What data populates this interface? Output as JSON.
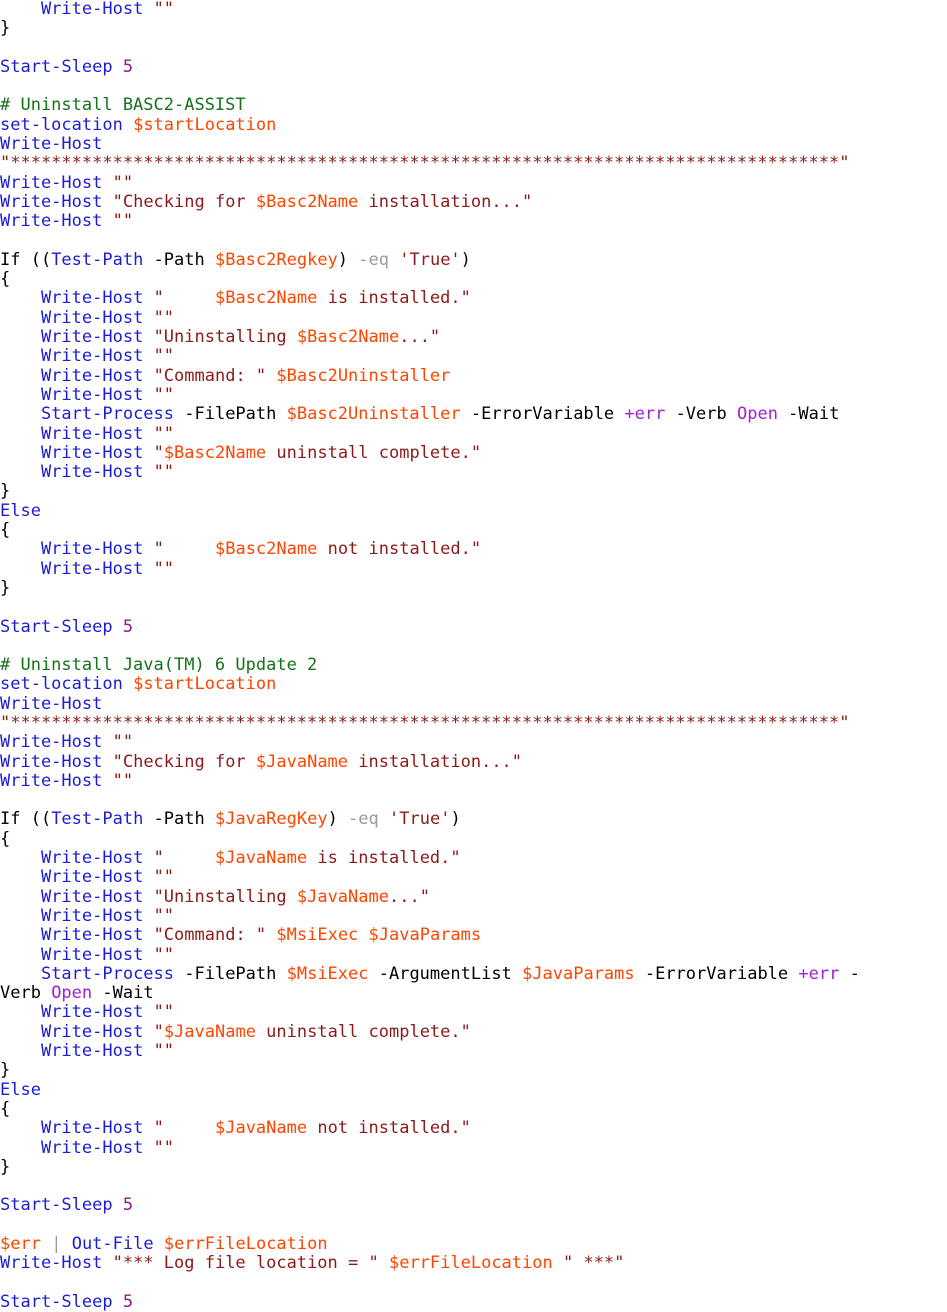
{
  "document": {
    "title": "PowerShell Uninstall Script",
    "language": "PowerShell",
    "font_size_px": 17,
    "line_height_px": 19.3
  },
  "colors": {
    "background": "#ffffff",
    "plain": "#000000",
    "cmdlet": "#1c1cd4",
    "keyword": "#1c1cd4",
    "variable": "#ff4500",
    "string": "#8b1a1a",
    "comment": "#14731a",
    "operator": "#9a9a9a",
    "number": "#8b1a8b",
    "magenta": "#a020d0"
  },
  "lines": [
    {
      "i": 1,
      "tokens": [
        {
          "t": "    ",
          "c": "pln"
        },
        {
          "t": "Write-Host",
          "c": "cmd"
        },
        {
          "t": " ",
          "c": "pln"
        },
        {
          "t": "\"\"",
          "c": "str"
        }
      ]
    },
    {
      "i": 2,
      "tokens": [
        {
          "t": "}",
          "c": "pln"
        }
      ]
    },
    {
      "i": 3,
      "tokens": [
        {
          "t": "",
          "c": "pln"
        }
      ]
    },
    {
      "i": 4,
      "tokens": [
        {
          "t": "Start-Sleep",
          "c": "cmd"
        },
        {
          "t": " ",
          "c": "pln"
        },
        {
          "t": "5",
          "c": "num"
        }
      ]
    },
    {
      "i": 5,
      "tokens": [
        {
          "t": "",
          "c": "pln"
        }
      ]
    },
    {
      "i": 6,
      "tokens": [
        {
          "t": "# Uninstall BASC2-ASSIST",
          "c": "cmt"
        }
      ]
    },
    {
      "i": 7,
      "tokens": [
        {
          "t": "set-location",
          "c": "cmd"
        },
        {
          "t": " ",
          "c": "pln"
        },
        {
          "t": "$startLocation",
          "c": "var"
        }
      ]
    },
    {
      "i": 8,
      "tokens": [
        {
          "t": "Write-Host",
          "c": "cmd"
        }
      ]
    },
    {
      "i": 9,
      "tokens": [
        {
          "t": "\"*********************************************************************************\"",
          "c": "str"
        }
      ]
    },
    {
      "i": 10,
      "tokens": [
        {
          "t": "Write-Host",
          "c": "cmd"
        },
        {
          "t": " ",
          "c": "pln"
        },
        {
          "t": "\"\"",
          "c": "str"
        }
      ]
    },
    {
      "i": 11,
      "tokens": [
        {
          "t": "Write-Host",
          "c": "cmd"
        },
        {
          "t": " ",
          "c": "pln"
        },
        {
          "t": "\"Checking for ",
          "c": "str"
        },
        {
          "t": "$Basc2Name",
          "c": "var"
        },
        {
          "t": " installation...\"",
          "c": "str"
        }
      ]
    },
    {
      "i": 12,
      "tokens": [
        {
          "t": "Write-Host",
          "c": "cmd"
        },
        {
          "t": " ",
          "c": "pln"
        },
        {
          "t": "\"\"",
          "c": "str"
        }
      ]
    },
    {
      "i": 13,
      "tokens": [
        {
          "t": "",
          "c": "pln"
        }
      ]
    },
    {
      "i": 14,
      "tokens": [
        {
          "t": "If ((",
          "c": "pln"
        },
        {
          "t": "Test-Path",
          "c": "cmd"
        },
        {
          "t": " -Path ",
          "c": "pln"
        },
        {
          "t": "$Basc2Regkey",
          "c": "var"
        },
        {
          "t": ") ",
          "c": "pln"
        },
        {
          "t": "-eq",
          "c": "op"
        },
        {
          "t": " ",
          "c": "pln"
        },
        {
          "t": "'True'",
          "c": "str"
        },
        {
          "t": ")",
          "c": "pln"
        }
      ]
    },
    {
      "i": 15,
      "tokens": [
        {
          "t": "{",
          "c": "pln"
        }
      ]
    },
    {
      "i": 16,
      "tokens": [
        {
          "t": "    ",
          "c": "pln"
        },
        {
          "t": "Write-Host",
          "c": "cmd"
        },
        {
          "t": " ",
          "c": "pln"
        },
        {
          "t": "\"     ",
          "c": "str"
        },
        {
          "t": "$Basc2Name",
          "c": "var"
        },
        {
          "t": " is installed.\"",
          "c": "str"
        }
      ]
    },
    {
      "i": 17,
      "tokens": [
        {
          "t": "    ",
          "c": "pln"
        },
        {
          "t": "Write-Host",
          "c": "cmd"
        },
        {
          "t": " ",
          "c": "pln"
        },
        {
          "t": "\"\"",
          "c": "str"
        }
      ]
    },
    {
      "i": 18,
      "tokens": [
        {
          "t": "    ",
          "c": "pln"
        },
        {
          "t": "Write-Host",
          "c": "cmd"
        },
        {
          "t": " ",
          "c": "pln"
        },
        {
          "t": "\"Uninstalling ",
          "c": "str"
        },
        {
          "t": "$Basc2Name",
          "c": "var"
        },
        {
          "t": "...\"",
          "c": "str"
        }
      ]
    },
    {
      "i": 19,
      "tokens": [
        {
          "t": "    ",
          "c": "pln"
        },
        {
          "t": "Write-Host",
          "c": "cmd"
        },
        {
          "t": " ",
          "c": "pln"
        },
        {
          "t": "\"\"",
          "c": "str"
        }
      ]
    },
    {
      "i": 20,
      "tokens": [
        {
          "t": "    ",
          "c": "pln"
        },
        {
          "t": "Write-Host",
          "c": "cmd"
        },
        {
          "t": " ",
          "c": "pln"
        },
        {
          "t": "\"Command: \"",
          "c": "str"
        },
        {
          "t": " ",
          "c": "pln"
        },
        {
          "t": "$Basc2Uninstaller",
          "c": "var"
        }
      ]
    },
    {
      "i": 21,
      "tokens": [
        {
          "t": "    ",
          "c": "pln"
        },
        {
          "t": "Write-Host",
          "c": "cmd"
        },
        {
          "t": " ",
          "c": "pln"
        },
        {
          "t": "\"\"",
          "c": "str"
        }
      ]
    },
    {
      "i": 22,
      "tokens": [
        {
          "t": "    ",
          "c": "pln"
        },
        {
          "t": "Start-Process",
          "c": "cmd"
        },
        {
          "t": " -FilePath ",
          "c": "pln"
        },
        {
          "t": "$Basc2Uninstaller",
          "c": "var"
        },
        {
          "t": " -ErrorVariable ",
          "c": "pln"
        },
        {
          "t": "+err",
          "c": "mag"
        },
        {
          "t": " -Verb ",
          "c": "pln"
        },
        {
          "t": "Open",
          "c": "mag"
        },
        {
          "t": " -Wait",
          "c": "pln"
        }
      ]
    },
    {
      "i": 23,
      "tokens": [
        {
          "t": "    ",
          "c": "pln"
        },
        {
          "t": "Write-Host",
          "c": "cmd"
        },
        {
          "t": " ",
          "c": "pln"
        },
        {
          "t": "\"\"",
          "c": "str"
        }
      ]
    },
    {
      "i": 24,
      "tokens": [
        {
          "t": "    ",
          "c": "pln"
        },
        {
          "t": "Write-Host",
          "c": "cmd"
        },
        {
          "t": " ",
          "c": "pln"
        },
        {
          "t": "\"",
          "c": "str"
        },
        {
          "t": "$Basc2Name",
          "c": "var"
        },
        {
          "t": " uninstall complete.\"",
          "c": "str"
        }
      ]
    },
    {
      "i": 25,
      "tokens": [
        {
          "t": "    ",
          "c": "pln"
        },
        {
          "t": "Write-Host",
          "c": "cmd"
        },
        {
          "t": " ",
          "c": "pln"
        },
        {
          "t": "\"\"",
          "c": "str"
        }
      ]
    },
    {
      "i": 26,
      "tokens": [
        {
          "t": "}",
          "c": "pln"
        }
      ]
    },
    {
      "i": 27,
      "tokens": [
        {
          "t": "Else",
          "c": "kw"
        }
      ]
    },
    {
      "i": 28,
      "tokens": [
        {
          "t": "{",
          "c": "pln"
        }
      ]
    },
    {
      "i": 29,
      "tokens": [
        {
          "t": "    ",
          "c": "pln"
        },
        {
          "t": "Write-Host",
          "c": "cmd"
        },
        {
          "t": " ",
          "c": "pln"
        },
        {
          "t": "\"     ",
          "c": "str"
        },
        {
          "t": "$Basc2Name",
          "c": "var"
        },
        {
          "t": " not installed.\"",
          "c": "str"
        }
      ]
    },
    {
      "i": 30,
      "tokens": [
        {
          "t": "    ",
          "c": "pln"
        },
        {
          "t": "Write-Host",
          "c": "cmd"
        },
        {
          "t": " ",
          "c": "pln"
        },
        {
          "t": "\"\"",
          "c": "str"
        }
      ]
    },
    {
      "i": 31,
      "tokens": [
        {
          "t": "}",
          "c": "pln"
        }
      ]
    },
    {
      "i": 32,
      "tokens": [
        {
          "t": "",
          "c": "pln"
        }
      ]
    },
    {
      "i": 33,
      "tokens": [
        {
          "t": "Start-Sleep",
          "c": "cmd"
        },
        {
          "t": " ",
          "c": "pln"
        },
        {
          "t": "5",
          "c": "num"
        }
      ]
    },
    {
      "i": 34,
      "tokens": [
        {
          "t": "",
          "c": "pln"
        }
      ]
    },
    {
      "i": 35,
      "tokens": [
        {
          "t": "# Uninstall Java(TM) 6 Update 2",
          "c": "cmt"
        }
      ]
    },
    {
      "i": 36,
      "tokens": [
        {
          "t": "set-location",
          "c": "cmd"
        },
        {
          "t": " ",
          "c": "pln"
        },
        {
          "t": "$startLocation",
          "c": "var"
        }
      ]
    },
    {
      "i": 37,
      "tokens": [
        {
          "t": "Write-Host",
          "c": "cmd"
        }
      ]
    },
    {
      "i": 38,
      "tokens": [
        {
          "t": "\"*********************************************************************************\"",
          "c": "str"
        }
      ]
    },
    {
      "i": 39,
      "tokens": [
        {
          "t": "Write-Host",
          "c": "cmd"
        },
        {
          "t": " ",
          "c": "pln"
        },
        {
          "t": "\"\"",
          "c": "str"
        }
      ]
    },
    {
      "i": 40,
      "tokens": [
        {
          "t": "Write-Host",
          "c": "cmd"
        },
        {
          "t": " ",
          "c": "pln"
        },
        {
          "t": "\"Checking for ",
          "c": "str"
        },
        {
          "t": "$JavaName",
          "c": "var"
        },
        {
          "t": " installation...\"",
          "c": "str"
        }
      ]
    },
    {
      "i": 41,
      "tokens": [
        {
          "t": "Write-Host",
          "c": "cmd"
        },
        {
          "t": " ",
          "c": "pln"
        },
        {
          "t": "\"\"",
          "c": "str"
        }
      ]
    },
    {
      "i": 42,
      "tokens": [
        {
          "t": "",
          "c": "pln"
        }
      ]
    },
    {
      "i": 43,
      "tokens": [
        {
          "t": "If ((",
          "c": "pln"
        },
        {
          "t": "Test-Path",
          "c": "cmd"
        },
        {
          "t": " -Path ",
          "c": "pln"
        },
        {
          "t": "$JavaRegKey",
          "c": "var"
        },
        {
          "t": ") ",
          "c": "pln"
        },
        {
          "t": "-eq",
          "c": "op"
        },
        {
          "t": " ",
          "c": "pln"
        },
        {
          "t": "'True'",
          "c": "str"
        },
        {
          "t": ")",
          "c": "pln"
        }
      ]
    },
    {
      "i": 44,
      "tokens": [
        {
          "t": "{",
          "c": "pln"
        }
      ]
    },
    {
      "i": 45,
      "tokens": [
        {
          "t": "    ",
          "c": "pln"
        },
        {
          "t": "Write-Host",
          "c": "cmd"
        },
        {
          "t": " ",
          "c": "pln"
        },
        {
          "t": "\"     ",
          "c": "str"
        },
        {
          "t": "$JavaName",
          "c": "var"
        },
        {
          "t": " is installed.\"",
          "c": "str"
        }
      ]
    },
    {
      "i": 46,
      "tokens": [
        {
          "t": "    ",
          "c": "pln"
        },
        {
          "t": "Write-Host",
          "c": "cmd"
        },
        {
          "t": " ",
          "c": "pln"
        },
        {
          "t": "\"\"",
          "c": "str"
        }
      ]
    },
    {
      "i": 47,
      "tokens": [
        {
          "t": "    ",
          "c": "pln"
        },
        {
          "t": "Write-Host",
          "c": "cmd"
        },
        {
          "t": " ",
          "c": "pln"
        },
        {
          "t": "\"Uninstalling ",
          "c": "str"
        },
        {
          "t": "$JavaName",
          "c": "var"
        },
        {
          "t": "...\"",
          "c": "str"
        }
      ]
    },
    {
      "i": 48,
      "tokens": [
        {
          "t": "    ",
          "c": "pln"
        },
        {
          "t": "Write-Host",
          "c": "cmd"
        },
        {
          "t": " ",
          "c": "pln"
        },
        {
          "t": "\"\"",
          "c": "str"
        }
      ]
    },
    {
      "i": 49,
      "tokens": [
        {
          "t": "    ",
          "c": "pln"
        },
        {
          "t": "Write-Host",
          "c": "cmd"
        },
        {
          "t": " ",
          "c": "pln"
        },
        {
          "t": "\"Command: \"",
          "c": "str"
        },
        {
          "t": " ",
          "c": "pln"
        },
        {
          "t": "$MsiExec",
          "c": "var"
        },
        {
          "t": " ",
          "c": "pln"
        },
        {
          "t": "$JavaParams",
          "c": "var"
        }
      ]
    },
    {
      "i": 50,
      "tokens": [
        {
          "t": "    ",
          "c": "pln"
        },
        {
          "t": "Write-Host",
          "c": "cmd"
        },
        {
          "t": " ",
          "c": "pln"
        },
        {
          "t": "\"\"",
          "c": "str"
        }
      ]
    },
    {
      "i": 51,
      "tokens": [
        {
          "t": "    ",
          "c": "pln"
        },
        {
          "t": "Start-Process",
          "c": "cmd"
        },
        {
          "t": " -FilePath ",
          "c": "pln"
        },
        {
          "t": "$MsiExec",
          "c": "var"
        },
        {
          "t": " -ArgumentList ",
          "c": "pln"
        },
        {
          "t": "$JavaParams",
          "c": "var"
        },
        {
          "t": " -ErrorVariable ",
          "c": "pln"
        },
        {
          "t": "+err",
          "c": "mag"
        },
        {
          "t": " -",
          "c": "pln"
        }
      ]
    },
    {
      "i": 52,
      "tokens": [
        {
          "t": "Verb ",
          "c": "pln"
        },
        {
          "t": "Open",
          "c": "mag"
        },
        {
          "t": " -Wait",
          "c": "pln"
        }
      ]
    },
    {
      "i": 53,
      "tokens": [
        {
          "t": "    ",
          "c": "pln"
        },
        {
          "t": "Write-Host",
          "c": "cmd"
        },
        {
          "t": " ",
          "c": "pln"
        },
        {
          "t": "\"\"",
          "c": "str"
        }
      ]
    },
    {
      "i": 54,
      "tokens": [
        {
          "t": "    ",
          "c": "pln"
        },
        {
          "t": "Write-Host",
          "c": "cmd"
        },
        {
          "t": " ",
          "c": "pln"
        },
        {
          "t": "\"",
          "c": "str"
        },
        {
          "t": "$JavaName",
          "c": "var"
        },
        {
          "t": " uninstall complete.\"",
          "c": "str"
        }
      ]
    },
    {
      "i": 55,
      "tokens": [
        {
          "t": "    ",
          "c": "pln"
        },
        {
          "t": "Write-Host",
          "c": "cmd"
        },
        {
          "t": " ",
          "c": "pln"
        },
        {
          "t": "\"\"",
          "c": "str"
        }
      ]
    },
    {
      "i": 56,
      "tokens": [
        {
          "t": "}",
          "c": "pln"
        }
      ]
    },
    {
      "i": 57,
      "tokens": [
        {
          "t": "Else",
          "c": "kw"
        }
      ]
    },
    {
      "i": 58,
      "tokens": [
        {
          "t": "{",
          "c": "pln"
        }
      ]
    },
    {
      "i": 59,
      "tokens": [
        {
          "t": "    ",
          "c": "pln"
        },
        {
          "t": "Write-Host",
          "c": "cmd"
        },
        {
          "t": " ",
          "c": "pln"
        },
        {
          "t": "\"     ",
          "c": "str"
        },
        {
          "t": "$JavaName",
          "c": "var"
        },
        {
          "t": " not installed.\"",
          "c": "str"
        }
      ]
    },
    {
      "i": 60,
      "tokens": [
        {
          "t": "    ",
          "c": "pln"
        },
        {
          "t": "Write-Host",
          "c": "cmd"
        },
        {
          "t": " ",
          "c": "pln"
        },
        {
          "t": "\"\"",
          "c": "str"
        }
      ]
    },
    {
      "i": 61,
      "tokens": [
        {
          "t": "}",
          "c": "pln"
        }
      ]
    },
    {
      "i": 62,
      "tokens": [
        {
          "t": "",
          "c": "pln"
        }
      ]
    },
    {
      "i": 63,
      "tokens": [
        {
          "t": "Start-Sleep",
          "c": "cmd"
        },
        {
          "t": " ",
          "c": "pln"
        },
        {
          "t": "5",
          "c": "num"
        }
      ]
    },
    {
      "i": 64,
      "tokens": [
        {
          "t": "",
          "c": "pln"
        }
      ]
    },
    {
      "i": 65,
      "tokens": [
        {
          "t": "$err",
          "c": "var"
        },
        {
          "t": " ",
          "c": "pln"
        },
        {
          "t": "|",
          "c": "op"
        },
        {
          "t": " ",
          "c": "pln"
        },
        {
          "t": "Out-File",
          "c": "cmd"
        },
        {
          "t": " ",
          "c": "pln"
        },
        {
          "t": "$errFileLocation",
          "c": "var"
        }
      ]
    },
    {
      "i": 66,
      "tokens": [
        {
          "t": "Write-Host",
          "c": "cmd"
        },
        {
          "t": " ",
          "c": "pln"
        },
        {
          "t": "\"*** Log file location = \"",
          "c": "str"
        },
        {
          "t": " ",
          "c": "pln"
        },
        {
          "t": "$errFileLocation",
          "c": "var"
        },
        {
          "t": " ",
          "c": "pln"
        },
        {
          "t": "\" ***\"",
          "c": "str"
        }
      ]
    },
    {
      "i": 67,
      "tokens": [
        {
          "t": "",
          "c": "pln"
        }
      ]
    },
    {
      "i": 68,
      "tokens": [
        {
          "t": "Start-Sleep",
          "c": "cmd"
        },
        {
          "t": " ",
          "c": "pln"
        },
        {
          "t": "5",
          "c": "num"
        }
      ]
    }
  ]
}
